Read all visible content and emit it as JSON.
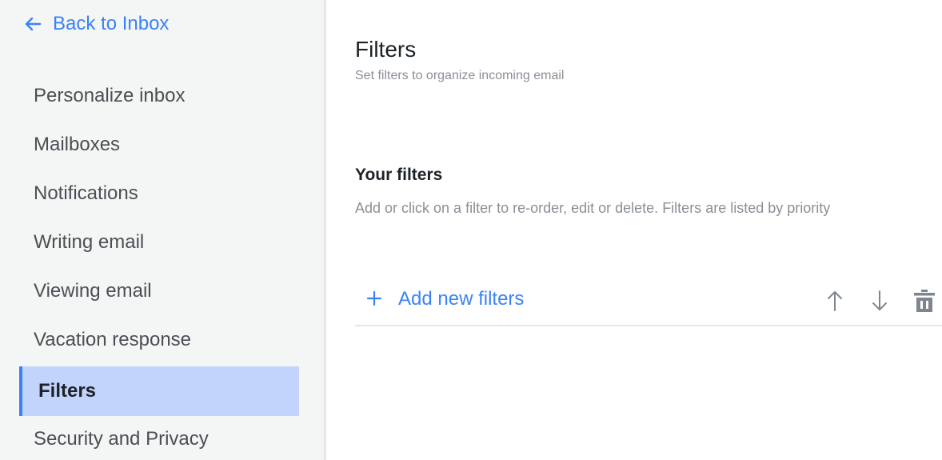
{
  "sidebar": {
    "back_label": "Back to Inbox",
    "items": [
      {
        "label": "Personalize inbox"
      },
      {
        "label": "Mailboxes"
      },
      {
        "label": "Notifications"
      },
      {
        "label": "Writing email"
      },
      {
        "label": "Viewing email"
      },
      {
        "label": "Vacation response"
      },
      {
        "label": "Filters",
        "active": true
      },
      {
        "label": "Security and Privacy"
      }
    ]
  },
  "main": {
    "title": "Filters",
    "subtitle": "Set filters to organize incoming email",
    "section_title": "Your filters",
    "section_desc": "Add or click on a filter to re-order, edit or delete. Filters are listed by priority",
    "add_label": "Add new filters",
    "add_icon": "plus-icon",
    "action_icons": [
      "arrow-up-icon",
      "arrow-down-icon",
      "trash-icon"
    ]
  },
  "colors": {
    "accent": "#3b82f6",
    "sidebar_bg": "#f4f5f5",
    "active_bg": "#c2d4fc",
    "muted_text": "#8a8f96",
    "icon_gray": "#7f858d"
  }
}
